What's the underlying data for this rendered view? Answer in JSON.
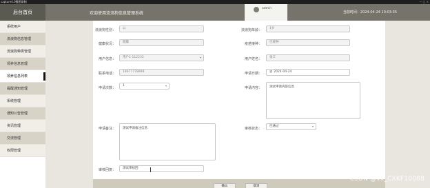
{
  "window": {
    "title": "capture4.0截图录制",
    "controls": "— □ ×"
  },
  "sidebar": {
    "logo": "后台首页",
    "items": [
      {
        "label": "系统用户"
      },
      {
        "label": "流浪狗信息管理"
      },
      {
        "label": "流浪狗种类管理"
      },
      {
        "label": "领养信息管理"
      },
      {
        "label": "领养信息列表"
      },
      {
        "label": "提醒通知管理"
      },
      {
        "label": "系统管理"
      },
      {
        "label": "通知公告管理"
      },
      {
        "label": "资讯管理"
      },
      {
        "label": "交流管理"
      },
      {
        "label": "权限管理"
      }
    ]
  },
  "header": {
    "site_title": "欢迎使用流浪狗信息管理系统",
    "username": "admin",
    "time": "当前时间：2024-04-24 10:03:35"
  },
  "form": {
    "dog_gender_label": "流浪狗性别：",
    "dog_gender_value": "公",
    "dog_age_label": "流浪狗年龄：",
    "dog_age_value": "1岁",
    "health_label": "健康状况：",
    "health_value": "健康",
    "vaccine_label": "疫苗接种：",
    "vaccine_value": "已接种",
    "user_info_label": "用户信息：",
    "user_info_value": "用户1-112233",
    "user_name_label": "用户姓名：",
    "user_name_value": "张三",
    "phone_label": "联系电话：",
    "phone_value": "18677778888",
    "apply_date_label": "申请日期：",
    "apply_date_value": "2024-04-24",
    "apply_count_label": "申请次数：",
    "apply_count_value": "1",
    "apply_content_label": "申请内容：",
    "apply_content_value": "测试申请内容信息",
    "apply_remark_label": "申请备注：",
    "apply_remark_value": "测试申请备注信息",
    "review_status_label": "审核状态：",
    "review_status_value": "已通过",
    "review_reply_label": "审核回复：",
    "review_reply_value": "测试审核回"
  },
  "buttons": {
    "confirm": "确认",
    "cancel": "取消"
  },
  "watermark": "CSDN @vx_CXKF10088"
}
